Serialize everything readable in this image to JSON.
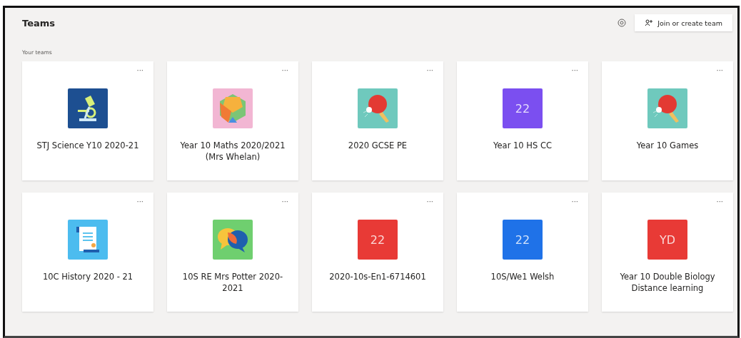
{
  "header": {
    "title": "Teams",
    "action_button": "Join or create team"
  },
  "section_label": "Your teams",
  "teams": [
    {
      "name": "STJ Science Y10 2020-21",
      "avatar": {
        "kind": "microscope",
        "color": "#1d4f91"
      },
      "more": "···"
    },
    {
      "name": "Year 10 Maths 2020/2021 (Mrs Whelan)",
      "avatar": {
        "kind": "polyhedron",
        "color": "#f2b6d3"
      },
      "more": "···"
    },
    {
      "name": "2020 GCSE PE",
      "avatar": {
        "kind": "paddle",
        "color": "#6fc9bd"
      },
      "more": "···"
    },
    {
      "name": "Year 10 HS CC",
      "avatar": {
        "kind": "initials",
        "text": "22",
        "color": "#7b4ff0"
      },
      "more": "···"
    },
    {
      "name": "Year 10 Games",
      "avatar": {
        "kind": "paddle",
        "color": "#6fc9bd"
      },
      "more": "···"
    },
    {
      "name": "10C History 2020 - 21",
      "avatar": {
        "kind": "scroll",
        "color": "#4cbcef"
      },
      "more": "···"
    },
    {
      "name": "10S RE Mrs Potter 2020-2021",
      "avatar": {
        "kind": "chat",
        "color": "#6fcf6f"
      },
      "more": "···"
    },
    {
      "name": "2020-10s-En1-6714601",
      "avatar": {
        "kind": "initials",
        "text": "22",
        "color": "#e83a36"
      },
      "more": "···"
    },
    {
      "name": "10S/We1 Welsh",
      "avatar": {
        "kind": "initials",
        "text": "22",
        "color": "#1f72e8"
      },
      "more": "···"
    },
    {
      "name": "Year 10 Double Biology Distance learning",
      "avatar": {
        "kind": "initials",
        "text": "YD",
        "color": "#e83a36"
      },
      "more": "···"
    }
  ]
}
